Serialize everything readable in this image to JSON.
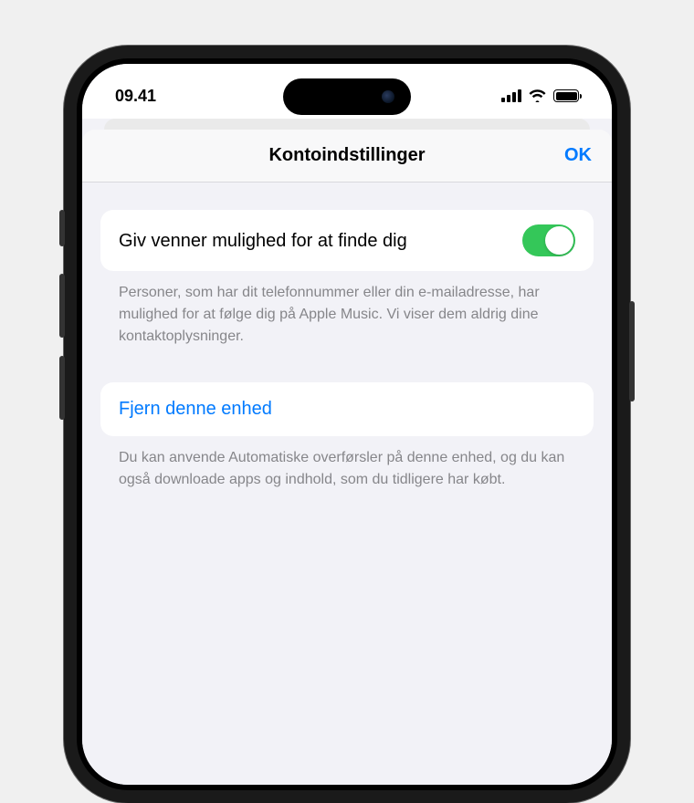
{
  "statusBar": {
    "time": "09.41"
  },
  "modal": {
    "title": "Kontoindstillinger",
    "ok_label": "OK"
  },
  "sections": {
    "findFriends": {
      "label": "Giv venner mulighed for at finde dig",
      "footer": "Personer, som har dit telefonnummer eller din e-mailadresse, har mulighed for at følge dig på Apple Music. Vi viser dem aldrig dine kontaktoplysninger.",
      "enabled": true
    },
    "removeDevice": {
      "label": "Fjern denne enhed",
      "footer": "Du kan anvende Automatiske overførsler på denne enhed, og du kan også downloade apps og indhold, som du tidligere har købt."
    }
  }
}
